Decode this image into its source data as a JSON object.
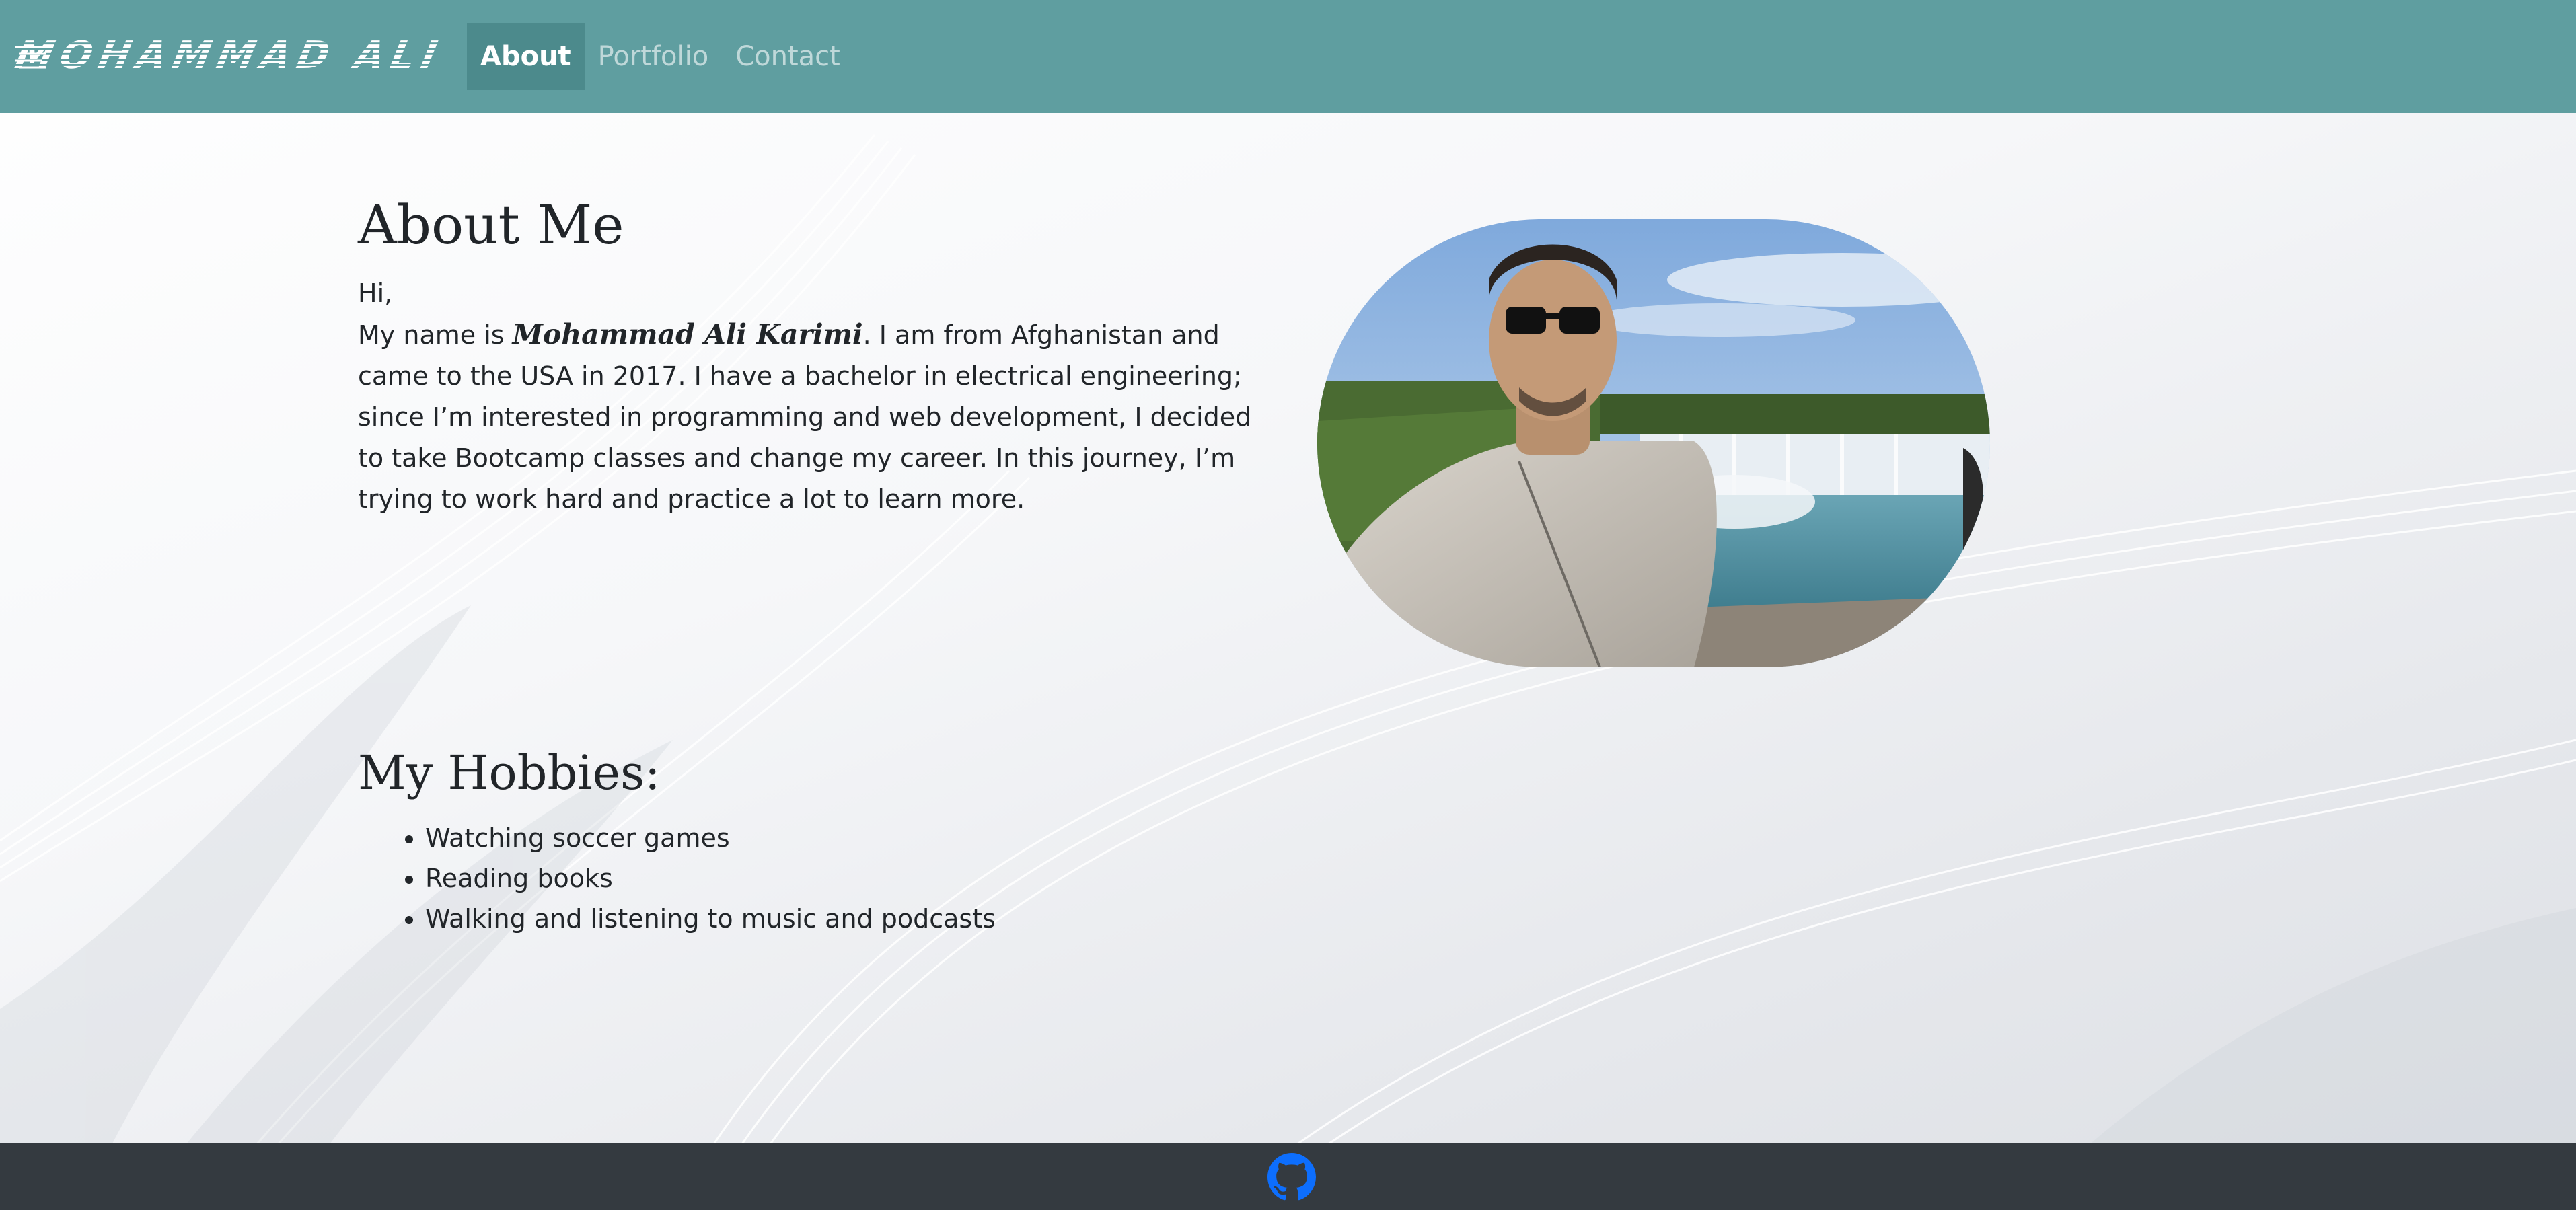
{
  "navbar": {
    "brand": "Mohammad Ali",
    "items": [
      {
        "label": "About",
        "active": true
      },
      {
        "label": "Portfolio",
        "active": false
      },
      {
        "label": "Contact",
        "active": false
      }
    ],
    "background_color": "#5f9ea0",
    "active_item_color": "#4c8a8c"
  },
  "about": {
    "title": "About Me",
    "greeting": "Hi,",
    "intro_before_name": "My name is ",
    "name": "Mohammad Ali Karimi",
    "intro_after_name": ". I am from Afghanistan and came to the USA in 2017. I have a bachelor in electrical engineering; since I’m interested in programming and web development, I decided to take Bootcamp classes and change my career. In this journey, I’m trying to work hard and practice a lot to learn more.",
    "photo_description": "man in sunglasses in front of waterfall"
  },
  "hobbies": {
    "title": "My Hobbies:",
    "items": [
      "Watching soccer games",
      "Reading books",
      "Walking and listening to music and podcasts"
    ]
  },
  "footer": {
    "icon": "github-icon",
    "background_color": "#343a40",
    "icon_color": "#0d6efd"
  }
}
